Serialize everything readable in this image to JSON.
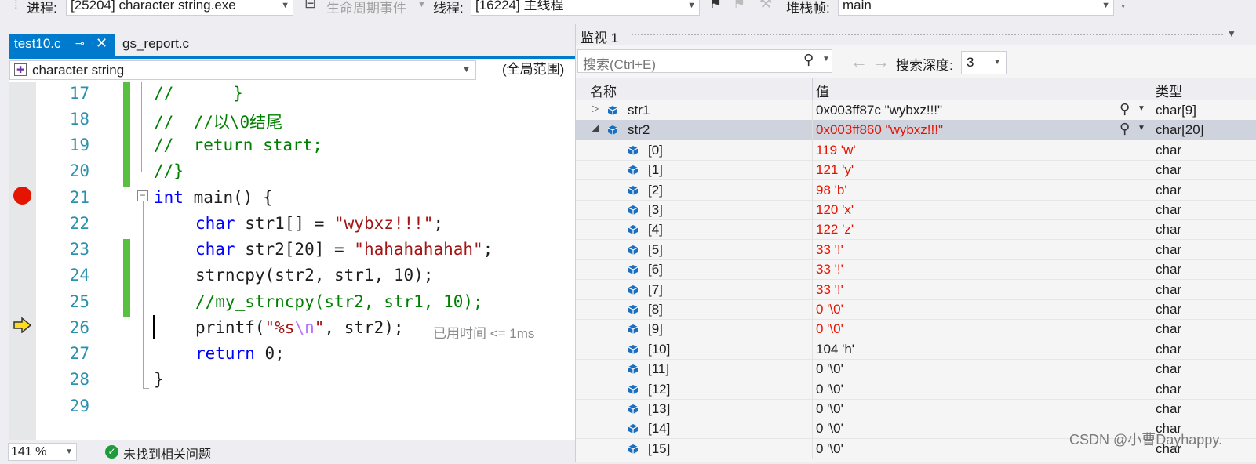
{
  "toolbar": {
    "process_label": "进程:",
    "process_value": "[25204] character string.exe",
    "lifecycle_label": "生命周期事件",
    "thread_label": "线程:",
    "thread_value": "[16224] 主线程",
    "stackframe_label": "堆栈帧:",
    "stackframe_value": "main"
  },
  "editor": {
    "tabs": [
      {
        "label": "test10.c",
        "active": true
      },
      {
        "label": "gs_report.c",
        "active": false
      }
    ],
    "nav_scope_combo": "character string",
    "nav_scope_global": "(全局范围)",
    "zoom": "141 %",
    "status_text": "未找到相关问题",
    "elapsed_hint": "已用时间 <= 1ms",
    "lines": [
      {
        "num": "17",
        "code": "//      }"
      },
      {
        "num": "18",
        "code": "//  //以\\0结尾"
      },
      {
        "num": "19",
        "code": "//  return start;"
      },
      {
        "num": "20",
        "code": "//}"
      },
      {
        "num": "21",
        "code": "int main() {"
      },
      {
        "num": "22",
        "code": "char str1[] = \"wybxz!!!\";"
      },
      {
        "num": "23",
        "code": "char str2[20] = \"hahahahahah\";"
      },
      {
        "num": "24",
        "code": "strncpy(str2, str1, 10);"
      },
      {
        "num": "25",
        "code": "//my_strncpy(str2, str1, 10);"
      },
      {
        "num": "26",
        "code": "printf(\"%s\\n\", str2);"
      },
      {
        "num": "27",
        "code": "return 0;"
      },
      {
        "num": "28",
        "code": "}"
      },
      {
        "num": "29",
        "code": ""
      }
    ],
    "code_parts": {
      "l17": "//      }",
      "l18": "//  //以\\0结尾",
      "l19": "//  return start;",
      "l20": "//}",
      "l21_kw": "int",
      "l21_rest": " main() {",
      "l22_kw": "char",
      "l22_a": " str1[] = ",
      "l22_str": "\"wybxz!!!\"",
      "l22_end": ";",
      "l23_kw": "char",
      "l23_a": " str2[20] = ",
      "l23_str": "\"hahahahahah\"",
      "l23_end": ";",
      "l24": "strncpy(str2, str1, 10);",
      "l25": "//my_strncpy(str2, str1, 10);",
      "l26_a": "printf(",
      "l26_str1": "\"%s",
      "l26_esc": "\\n",
      "l26_str2": "\"",
      "l26_end": ", str2);",
      "l27_kw": "return",
      "l27_rest": " 0;",
      "l28": "}"
    }
  },
  "watch": {
    "title": "监视 1",
    "search_placeholder": "搜索(Ctrl+E)",
    "search_depth_label": "搜索深度:",
    "search_depth_value": "3",
    "columns": {
      "name": "名称",
      "value": "值",
      "type": "类型"
    },
    "rows": [
      {
        "name": "str1",
        "value": "0x003ff87c \"wybxz!!!\"",
        "type": "char[9]",
        "expand": "▷",
        "changed": false
      },
      {
        "name": "str2",
        "value": "0x003ff860 \"wybxz!!!\"",
        "type": "char[20]",
        "expand": "◢",
        "changed": true
      },
      {
        "name": "[0]",
        "value": "119 'w'",
        "type": "char",
        "changed": true
      },
      {
        "name": "[1]",
        "value": "121 'y'",
        "type": "char",
        "changed": true
      },
      {
        "name": "[2]",
        "value": "98 'b'",
        "type": "char",
        "changed": true
      },
      {
        "name": "[3]",
        "value": "120 'x'",
        "type": "char",
        "changed": true
      },
      {
        "name": "[4]",
        "value": "122 'z'",
        "type": "char",
        "changed": true
      },
      {
        "name": "[5]",
        "value": "33 '!'",
        "type": "char",
        "changed": true
      },
      {
        "name": "[6]",
        "value": "33 '!'",
        "type": "char",
        "changed": true
      },
      {
        "name": "[7]",
        "value": "33 '!'",
        "type": "char",
        "changed": true
      },
      {
        "name": "[8]",
        "value": "0 '\\0'",
        "type": "char",
        "changed": true
      },
      {
        "name": "[9]",
        "value": "0 '\\0'",
        "type": "char",
        "changed": true
      },
      {
        "name": "[10]",
        "value": "104 'h'",
        "type": "char",
        "changed": false
      },
      {
        "name": "[11]",
        "value": "0 '\\0'",
        "type": "char",
        "changed": false
      },
      {
        "name": "[12]",
        "value": "0 '\\0'",
        "type": "char",
        "changed": false
      },
      {
        "name": "[13]",
        "value": "0 '\\0'",
        "type": "char",
        "changed": false
      },
      {
        "name": "[14]",
        "value": "0 '\\0'",
        "type": "char",
        "changed": false
      },
      {
        "name": "[15]",
        "value": "0 '\\0'",
        "type": "char",
        "changed": false
      }
    ]
  },
  "watermark": "CSDN @小曹Dayhappy.",
  "colors": {
    "accent": "#007acc",
    "changed_value": "#e51400",
    "breakpoint": "#e51400",
    "change_bar": "#57c13f",
    "comment": "#008000",
    "keyword": "#0000ff",
    "string": "#a31515"
  }
}
